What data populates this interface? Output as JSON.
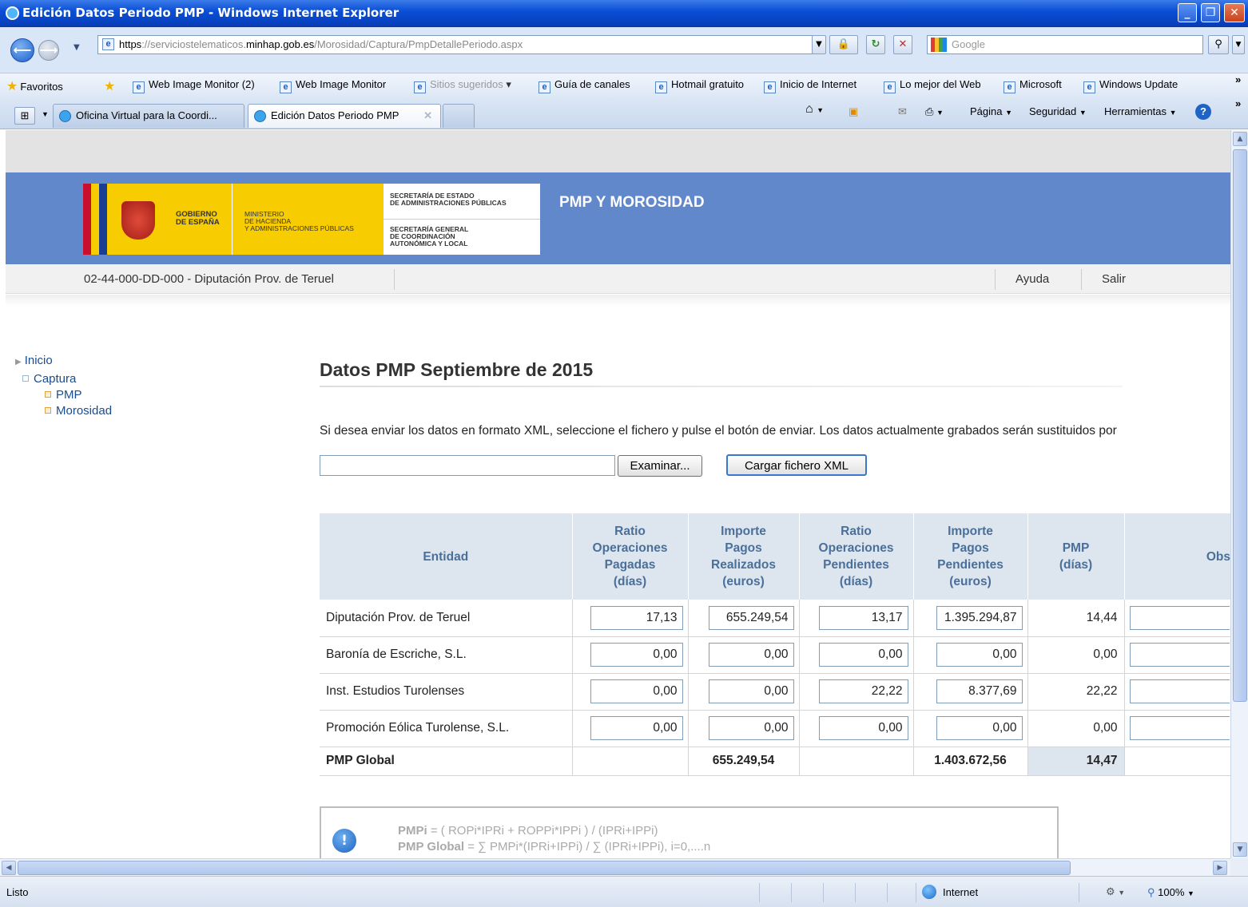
{
  "window": {
    "title": "Edición Datos Periodo PMP - Windows Internet Explorer"
  },
  "address": {
    "prefix": "https",
    "part1": "://serviciostelematicos.",
    "domain": "minhap.gob.es",
    "path": "/Morosidad/Captura/PmpDetallePeriodo.aspx"
  },
  "search": {
    "placeholder": "Google"
  },
  "favorites": {
    "label": "Favoritos",
    "items": [
      "Web Image Monitor (2)",
      "Web Image Monitor",
      "Sitios sugeridos",
      "Guía de canales",
      "Hotmail gratuito",
      "Inicio de Internet",
      "Lo mejor del Web",
      "Microsoft",
      "Windows Update"
    ]
  },
  "tabs": [
    {
      "label": "Oficina Virtual para la Coordi..."
    },
    {
      "label": "Edición Datos Periodo PMP"
    }
  ],
  "commandbar": {
    "page": "Página",
    "security": "Seguridad",
    "tools": "Herramientas"
  },
  "header": {
    "gobierno": [
      "GOBIERNO",
      "DE ESPAÑA"
    ],
    "ministerio": [
      "MINISTERIO",
      "DE HACIENDA",
      "Y ADMINISTRACIONES PÚBLICAS"
    ],
    "secretaria_estado": [
      "SECRETARÍA DE ESTADO",
      "DE ADMINISTRACIONES PÚBLICAS"
    ],
    "secretaria_general": [
      "SECRETARÍA GENERAL",
      "DE COORDINACIÓN",
      "AUTONÓMICA Y LOCAL"
    ],
    "app_title": "PMP Y MOROSIDAD"
  },
  "subnav": {
    "entity": "02-44-000-DD-000 - Diputación Prov. de Teruel",
    "help": "Ayuda",
    "logout": "Salir"
  },
  "tree": {
    "inicio": "Inicio",
    "captura": "Captura",
    "pmp": "PMP",
    "morosidad": "Morosidad"
  },
  "main": {
    "title": "Datos PMP Septiembre de 2015",
    "instruction": "Si desea enviar los datos en formato XML, seleccione el fichero y pulse el botón de enviar. Los datos actualmente grabados serán sustituidos por",
    "browse_button": "Examinar...",
    "upload_button": "Cargar fichero XML"
  },
  "table": {
    "headers": {
      "entity": "Entidad",
      "rop": [
        "Ratio",
        "Operaciones",
        "Pagadas",
        "(días)"
      ],
      "ipr": [
        "Importe",
        "Pagos",
        "Realizados",
        "(euros)"
      ],
      "ropp": [
        "Ratio",
        "Operaciones",
        "Pendientes",
        "(días)"
      ],
      "ipp": [
        "Importe",
        "Pagos",
        "Pendientes",
        "(euros)"
      ],
      "pmp": [
        "PMP",
        "(días)"
      ],
      "obs": "Obs"
    },
    "rows": [
      {
        "name": "Diputación Prov. de Teruel",
        "rop": "17,13",
        "ipr": "655.249,54",
        "ropp": "13,17",
        "ipp": "1.395.294,87",
        "pmp": "14,44"
      },
      {
        "name": "Baronía de Escriche, S.L.",
        "rop": "0,00",
        "ipr": "0,00",
        "ropp": "0,00",
        "ipp": "0,00",
        "pmp": "0,00"
      },
      {
        "name": "Inst. Estudios Turolenses",
        "rop": "0,00",
        "ipr": "0,00",
        "ropp": "22,22",
        "ipp": "8.377,69",
        "pmp": "22,22"
      },
      {
        "name": "Promoción Eólica Turolense, S.L.",
        "rop": "0,00",
        "ipr": "0,00",
        "ropp": "0,00",
        "ipp": "0,00",
        "pmp": "0,00"
      }
    ],
    "global": {
      "label": "PMP Global",
      "ipr": "655.249,54",
      "ipp": "1.403.672,56",
      "pmp": "14,47"
    }
  },
  "note": {
    "line1_label": "PMPi",
    "line1_formula": " = ( ROPi*IPRi + ROPPi*IPPi ) / (IPRi+IPPi)",
    "line2_label": "PMP Global",
    "line2_formula": " = ∑ PMPi*(IPRi+IPPi) / ∑ (IPRi+IPPi), i=0,....n"
  },
  "statusbar": {
    "text": "Listo",
    "zone": "Internet",
    "zoom": "100%"
  }
}
